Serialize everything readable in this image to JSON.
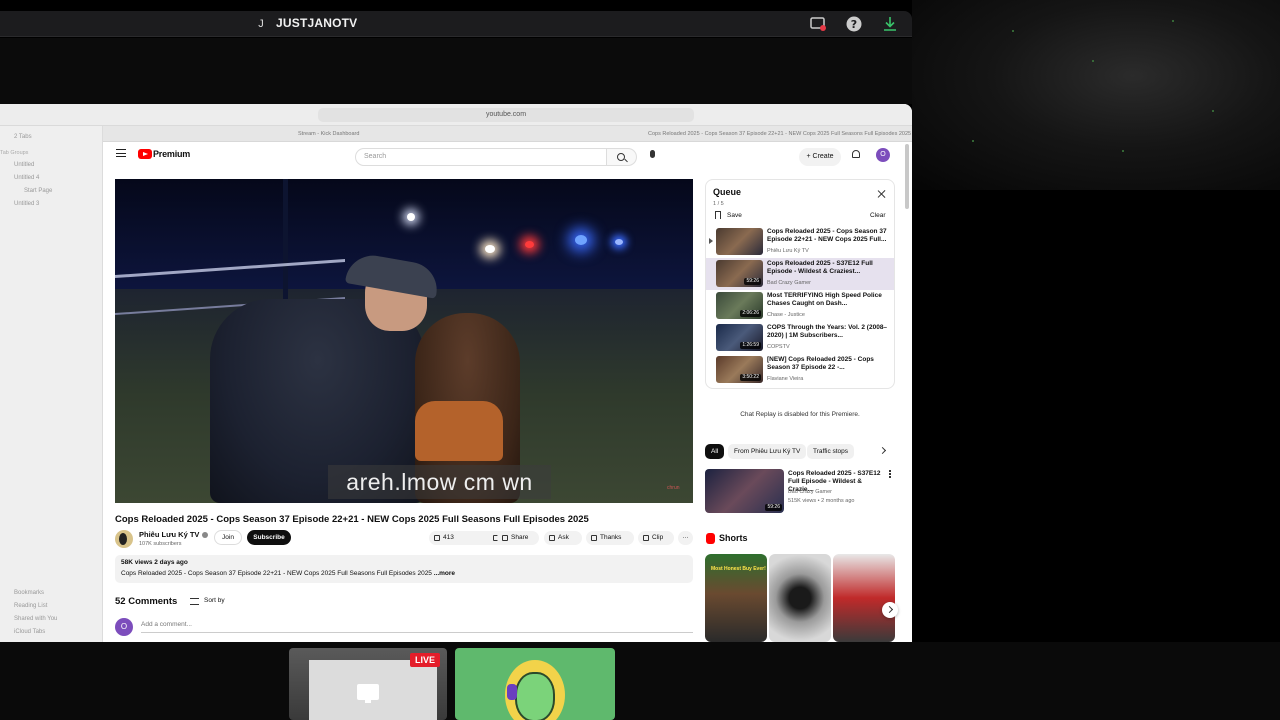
{
  "stream": {
    "avatar_letter": "J",
    "channel_name": "JUSTJANOTV",
    "live_label": "LIVE"
  },
  "browser": {
    "url": "youtube.com",
    "tabs": [
      "Stream - Kick Dashboard",
      "Cops Reloaded 2025 - Cops Season 37 Episode 22+21 - NEW Cops 2025 Full Seasons Full Episodes 2025"
    ],
    "sidebar": {
      "top": "2 Tabs",
      "group_header": "Tab Groups",
      "groups": [
        "Untitled",
        "Untitled 4",
        "Start Page",
        "Untitled 3"
      ],
      "bottom": [
        "Bookmarks",
        "Reading List",
        "Shared with You",
        "iCloud Tabs"
      ]
    }
  },
  "yt": {
    "brand": "Premium",
    "search_placeholder": "Search",
    "create_label": "Create",
    "avatar_letter": "O",
    "video": {
      "caption": "areh.lmow cm wn",
      "watermark": "chrun"
    },
    "title": "Cops Reloaded 2025 - Cops Season 37 Episode 22+21 - NEW Cops 2025 Full Seasons Full Episodes 2025",
    "channel": {
      "name": "Phiêu Lưu Ký TV",
      "subscribers": "107K subscribers",
      "join": "Join",
      "subscribe": "Subscribe"
    },
    "actions": {
      "likes": "413",
      "share": "Share",
      "ask": "Ask",
      "thanks": "Thanks",
      "clip": "Clip"
    },
    "description": {
      "meta": "58K views  2 days ago",
      "text": "Cops Reloaded 2025 - Cops Season 37 Episode 22+21 - NEW Cops 2025 Full Seasons Full Episodes 2025 ",
      "more": "...more"
    },
    "comments": {
      "count": "52 Comments",
      "sort": "Sort by",
      "add_placeholder": "Add a comment..."
    },
    "queue": {
      "title": "Queue",
      "count": "1 / 5",
      "save": "Save",
      "clear": "Clear",
      "items": [
        {
          "title": "Cops Reloaded 2025 - Cops Season 37 Episode 22+21 - NEW Cops 2025 Full...",
          "channel": "Phiêu Lưu Ký TV",
          "duration": ""
        },
        {
          "title": "Cops Reloaded 2025 - S37E12 Full Episode - Wildest & Craziest...",
          "channel": "Bad Crazy Gamer",
          "duration": "59:26"
        },
        {
          "title": "Most TERRIFYING High Speed Police Chases Caught on Dash...",
          "channel": "Chase - Justice",
          "duration": "2:06:26"
        },
        {
          "title": "COPS Through the Years: Vol. 2 (2008–2020) | 1M Subscribers...",
          "channel": "COPSTV",
          "duration": "1:26:59"
        },
        {
          "title": "[NEW] Cops Reloaded 2025 - Cops Season 37 Episode 22 -...",
          "channel": "Flaviane Vieira",
          "duration": "3:50:22"
        }
      ]
    },
    "chat_disabled": "Chat Replay is disabled for this Premiere.",
    "chips": [
      "All",
      "From Phiêu Lưu Ký TV",
      "Traffic stops"
    ],
    "recommended": {
      "title": "Cops Reloaded 2025 - S37E12 Full Episode - Wildest & Crazie...",
      "channel": "Bad Crazy Gamer",
      "meta": "515K views • 2 months ago",
      "duration": "59:26"
    },
    "shorts_title": "Shorts",
    "short1_text": "Most Honest Buy Ever!"
  },
  "colors": {
    "yt_red": "#ff0000",
    "live_red": "#e41d2a",
    "tile_green": "#5fb96d",
    "avatar_purple": "#7c4dbc"
  }
}
